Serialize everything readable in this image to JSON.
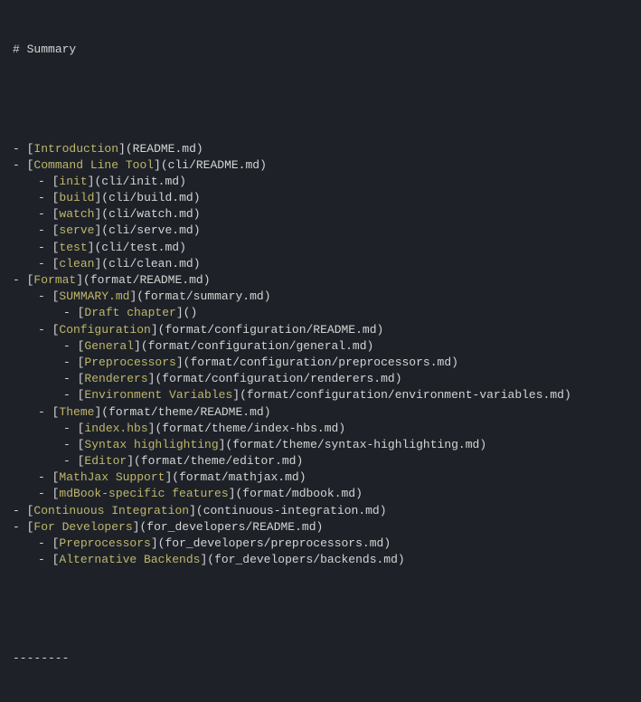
{
  "header": {
    "prefix": "# ",
    "text": "Summary"
  },
  "items": [
    {
      "indent": 0,
      "title": "Introduction",
      "path": "README.md"
    },
    {
      "indent": 0,
      "title": "Command Line Tool",
      "path": "cli/README.md"
    },
    {
      "indent": 1,
      "title": "init",
      "path": "cli/init.md"
    },
    {
      "indent": 1,
      "title": "build",
      "path": "cli/build.md"
    },
    {
      "indent": 1,
      "title": "watch",
      "path": "cli/watch.md"
    },
    {
      "indent": 1,
      "title": "serve",
      "path": "cli/serve.md"
    },
    {
      "indent": 1,
      "title": "test",
      "path": "cli/test.md"
    },
    {
      "indent": 1,
      "title": "clean",
      "path": "cli/clean.md"
    },
    {
      "indent": 0,
      "title": "Format",
      "path": "format/README.md"
    },
    {
      "indent": 1,
      "title": "SUMMARY.md",
      "path": "format/summary.md"
    },
    {
      "indent": 2,
      "title": "Draft chapter",
      "path": ""
    },
    {
      "indent": 1,
      "title": "Configuration",
      "path": "format/configuration/README.md"
    },
    {
      "indent": 2,
      "title": "General",
      "path": "format/configuration/general.md"
    },
    {
      "indent": 2,
      "title": "Preprocessors",
      "path": "format/configuration/preprocessors.md"
    },
    {
      "indent": 2,
      "title": "Renderers",
      "path": "format/configuration/renderers.md"
    },
    {
      "indent": 2,
      "title": "Environment Variables",
      "path": "format/configuration/environment-variables.md"
    },
    {
      "indent": 1,
      "title": "Theme",
      "path": "format/theme/README.md"
    },
    {
      "indent": 2,
      "title": "index.hbs",
      "path": "format/theme/index-hbs.md"
    },
    {
      "indent": 2,
      "title": "Syntax highlighting",
      "path": "format/theme/syntax-highlighting.md"
    },
    {
      "indent": 2,
      "title": "Editor",
      "path": "format/theme/editor.md"
    },
    {
      "indent": 1,
      "title": "MathJax Support",
      "path": "format/mathjax.md"
    },
    {
      "indent": 1,
      "title": "mdBook-specific features",
      "path": "format/mdbook.md"
    },
    {
      "indent": 0,
      "title": "Continuous Integration",
      "path": "continuous-integration.md"
    },
    {
      "indent": 0,
      "title": "For Developers",
      "path": "for_developers/README.md"
    },
    {
      "indent": 1,
      "title": "Preprocessors",
      "path": "for_developers/preprocessors.md"
    },
    {
      "indent": 1,
      "title": "Alternative Backends",
      "path": "for_developers/backends.md"
    }
  ],
  "dash": "- ",
  "bracket_open": "[",
  "bracket_close": "]",
  "paren_open": "(",
  "paren_close": ")",
  "hr": "--------"
}
